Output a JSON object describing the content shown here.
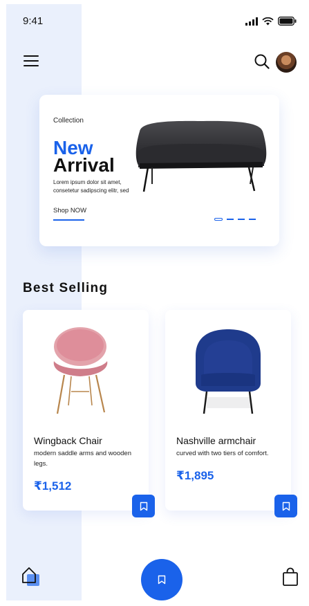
{
  "status": {
    "time": "9:41"
  },
  "banner": {
    "label": "Collection",
    "title_1": "New",
    "title_2": "Arrival",
    "description": "Lorem ipsum dolor sit amet, consetetur sadipscing elitr, sed",
    "link": "Shop NOW",
    "active_slide": 1,
    "slide_count": 4
  },
  "best_selling": {
    "title": "Best Selling",
    "products": [
      {
        "name": "Wingback Chair",
        "description": "modern saddle arms and wooden legs.",
        "price": "₹1,512",
        "color": "#de8e9a"
      },
      {
        "name": "Nashville armchair",
        "description": "curved with two tiers of comfort.",
        "price": "₹1,895",
        "color": "#1f3b8c"
      }
    ]
  },
  "colors": {
    "accent": "#1a62ea",
    "side_panel": "#eaf0fc"
  },
  "icons": [
    "menu-icon",
    "search-icon",
    "bookmark-icon",
    "home-icon",
    "shopping-bag-icon",
    "signal-icon",
    "wifi-icon",
    "battery-icon"
  ]
}
